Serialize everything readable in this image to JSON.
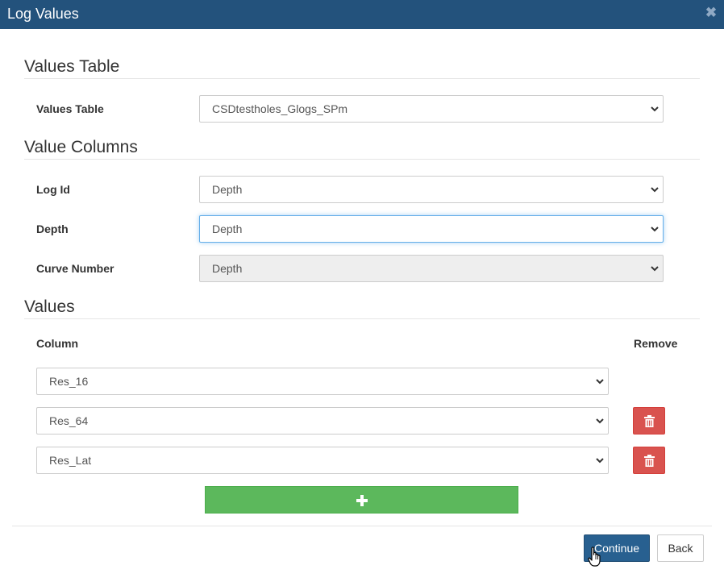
{
  "dialog": {
    "title": "Log Values"
  },
  "values_table_section": {
    "heading": "Values Table",
    "field_label": "Values Table",
    "selected": "CSDtestholes_Glogs_SPm"
  },
  "value_columns_section": {
    "heading": "Value Columns",
    "log_id": {
      "label": "Log Id",
      "selected": "Depth"
    },
    "depth": {
      "label": "Depth",
      "selected": "Depth"
    },
    "curve_number": {
      "label": "Curve Number",
      "selected": "Depth",
      "disabled": true
    }
  },
  "values_section": {
    "heading": "Values",
    "column_header": "Column",
    "remove_header": "Remove",
    "rows": [
      {
        "selected": "Res_16",
        "removable": false
      },
      {
        "selected": "Res_64",
        "removable": true
      },
      {
        "selected": "Res_Lat",
        "removable": true
      }
    ]
  },
  "footer": {
    "continue_label": "Continue",
    "back_label": "Back"
  },
  "colors": {
    "titlebar": "#23527c",
    "primary": "#286090",
    "danger": "#d9534f",
    "success": "#5cb85c"
  },
  "icons": {
    "close": "close-icon",
    "dropdown": "chevron-down-icon",
    "remove": "trash-icon",
    "add": "plus-icon",
    "cursor": "hand-pointer-icon"
  }
}
